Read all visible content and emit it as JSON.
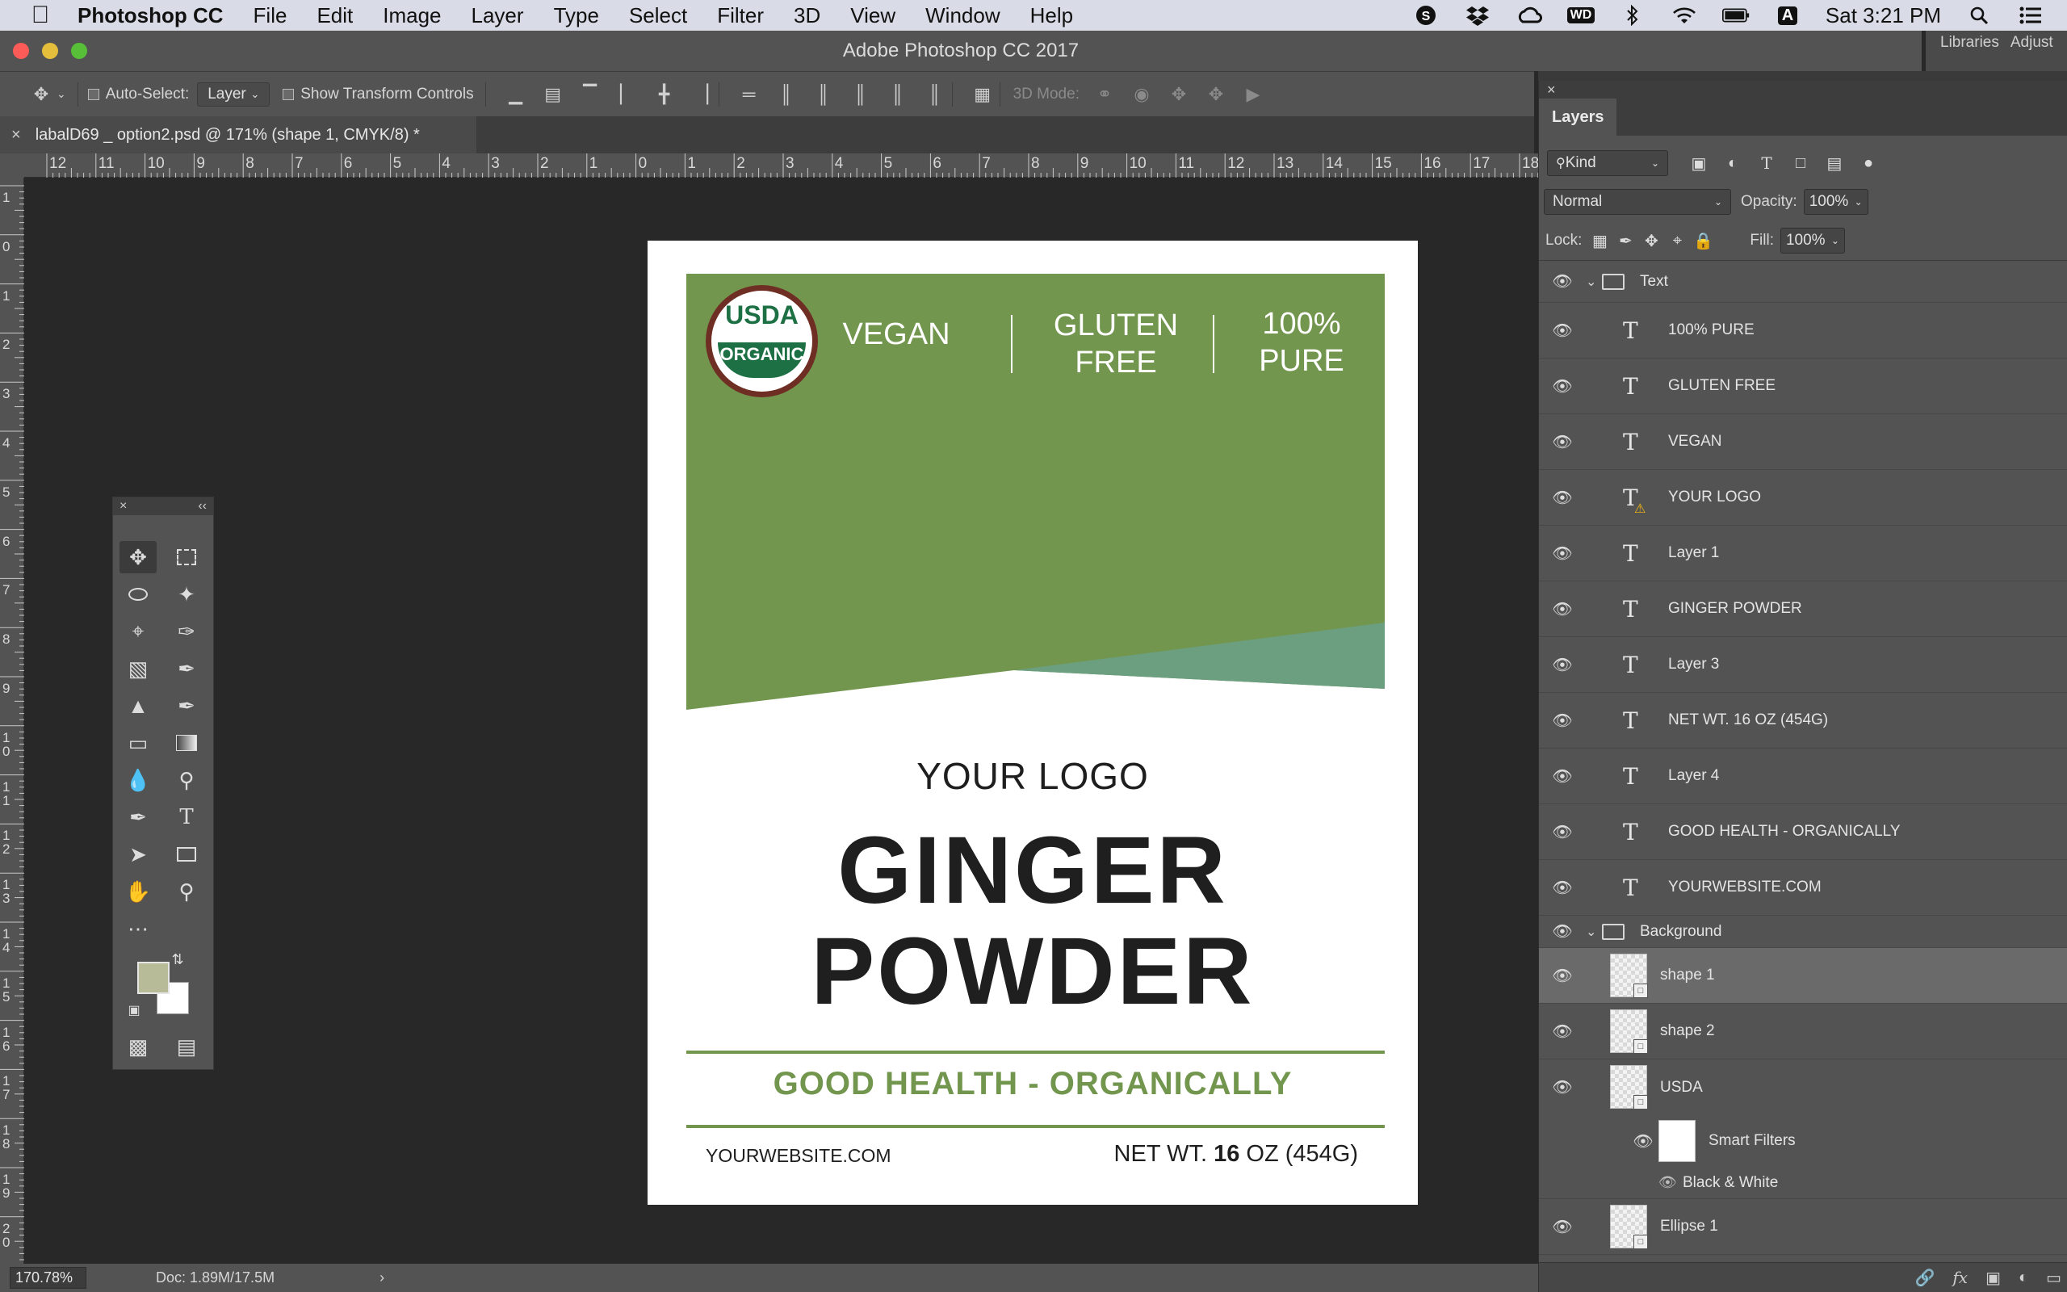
{
  "menubar": {
    "items": [
      "Photoshop CC",
      "File",
      "Edit",
      "Image",
      "Layer",
      "Type",
      "Select",
      "Filter",
      "3D",
      "View",
      "Window",
      "Help"
    ],
    "clock": "Sat 3:21 PM",
    "status_icons": [
      "skype-icon",
      "dropbox-icon",
      "creative-cloud-icon",
      "wd-icon",
      "bluetooth-icon",
      "wifi-icon",
      "battery-icon",
      "input-source-icon",
      "spotlight-icon",
      "notification-center-icon"
    ],
    "wd_label": "WD",
    "input_label": "A"
  },
  "window": {
    "title": "Adobe Photoshop CC 2017"
  },
  "options": {
    "auto_select_label": "Auto-Select:",
    "auto_select_value": "Layer",
    "show_transform_label": "Show Transform Controls",
    "mode3d_label": "3D Mode:"
  },
  "document": {
    "tab_title": "labalD69 _ option2.psd @ 171% (shape 1, CMYK/8) *"
  },
  "ruler": {
    "top": [
      "12",
      "11",
      "10",
      "9",
      "8",
      "7",
      "6",
      "5",
      "4",
      "3",
      "2",
      "1",
      "0",
      "1",
      "2",
      "3",
      "4",
      "5",
      "6",
      "7",
      "8",
      "9",
      "10",
      "11",
      "12",
      "13",
      "14",
      "15",
      "16",
      "17",
      "18"
    ],
    "left": [
      "1",
      "0",
      "1",
      "2",
      "3",
      "4",
      "5",
      "6",
      "7",
      "8",
      "9",
      "1 0",
      "1 1",
      "1 2",
      "1 3",
      "1 4",
      "1 5",
      "1 6",
      "1 7",
      "1 8",
      "1 9",
      "2 0"
    ]
  },
  "label": {
    "seal_top": "USDA",
    "seal_bottom": "ORGANIC",
    "claim_vegan": "VEGAN",
    "claim_gluten_1": "GLUTEN",
    "claim_gluten_2": "FREE",
    "claim_pure_1": "100%",
    "claim_pure_2": "PURE",
    "logo": "YOUR LOGO",
    "title_1": "GINGER",
    "title_2": "POWDER",
    "tagline": "GOOD HEALTH - ORGANICALLY",
    "website": "YOURWEBSITE.COM",
    "net_prefix": "NET WT.",
    "net_bold": "16",
    "net_suffix": "OZ (454G)",
    "colors": {
      "green": "#73964f",
      "teal": "#6b9f80",
      "seal_brown": "#6f2e23",
      "seal_green": "#1c7044"
    }
  },
  "status": {
    "zoom": "170.78%",
    "doc": "Doc: 1.89M/17.5M"
  },
  "right_tabs": {
    "libraries": "Libraries",
    "adjust": "Adjust"
  },
  "layers_panel": {
    "tab": "Layers",
    "filter_kind": "Kind",
    "blend_mode": "Normal",
    "opacity_label": "Opacity:",
    "opacity": "100%",
    "lock_label": "Lock:",
    "fill_label": "Fill:",
    "fill": "100%",
    "groups": {
      "text": "Text",
      "background": "Background"
    },
    "text_layers": [
      "100% PURE",
      "GLUTEN FREE",
      "VEGAN",
      "YOUR LOGO",
      "Layer 1",
      "GINGER POWDER",
      "Layer 3",
      "NET WT. 16 OZ (454G)",
      "Layer 4",
      "GOOD HEALTH - ORGANICALLY",
      "YOURWEBSITE.COM"
    ],
    "bg_layers": {
      "shape1": "shape 1",
      "shape2": "shape 2",
      "usda": "USDA",
      "smart_filters": "Smart Filters",
      "bw": "Black & White",
      "ellipse": "Ellipse 1"
    }
  }
}
